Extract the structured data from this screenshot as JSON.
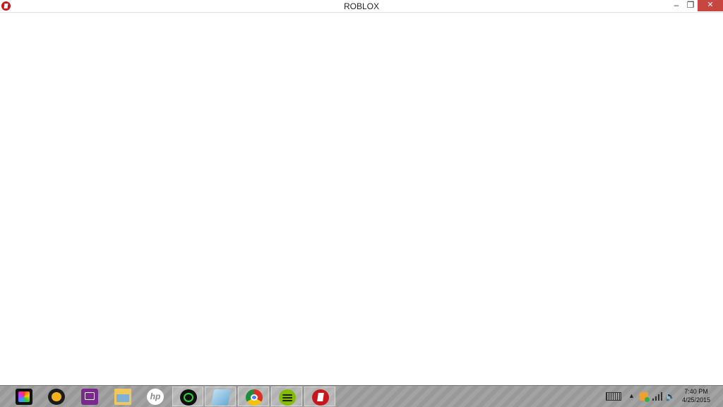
{
  "window": {
    "title": "ROBLOX",
    "buttons": {
      "minimize": "–",
      "maximize": "❐",
      "close": "✕"
    }
  },
  "taskbar": {
    "items": [
      {
        "icon": "colorful-tiles-app-icon",
        "active": false
      },
      {
        "icon": "media-player-icon",
        "active": false
      },
      {
        "icon": "purple-app-icon",
        "active": false
      },
      {
        "icon": "file-explorer-icon",
        "active": false
      },
      {
        "icon": "hp-icon",
        "active": false
      },
      {
        "icon": "green-ring-app-icon",
        "active": true
      },
      {
        "icon": "paper-app-icon",
        "active": true
      },
      {
        "icon": "chrome-icon",
        "active": true
      },
      {
        "icon": "spotify-icon",
        "active": true
      },
      {
        "icon": "roblox-icon",
        "active": true
      }
    ]
  },
  "tray": {
    "up_arrow": "▲",
    "volume": "🔈",
    "time": "7:40 PM",
    "date": "4/25/2015"
  },
  "colors": {
    "close_button": "#c7463f",
    "taskbar": "#9e9e9e",
    "roblox_red": "#c8161d"
  }
}
